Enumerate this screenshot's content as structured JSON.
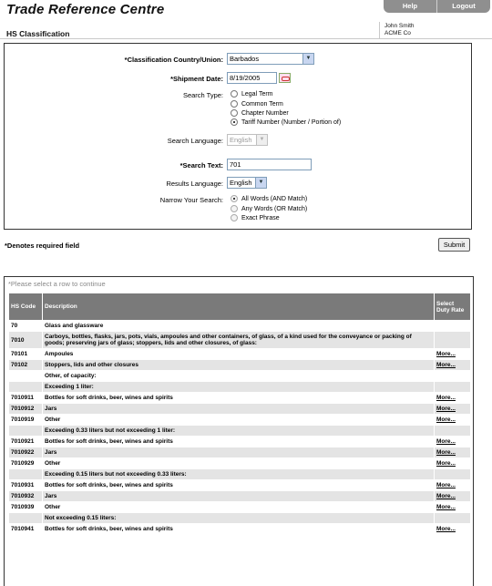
{
  "app_title": "Trade Reference Centre",
  "nav": {
    "help": "Help",
    "logout": "Logout"
  },
  "page_title": "HS Classification",
  "user": {
    "name": "John Smith",
    "company": "ACME Co"
  },
  "form": {
    "country_label": "*Classification Country/Union:",
    "country_value": "Barbados",
    "ship_date_label": "*Shipment Date:",
    "ship_date_value": "8/19/2005",
    "search_type_label": "Search Type:",
    "search_types": [
      {
        "label": "Legal Term",
        "selected": false
      },
      {
        "label": "Common Term",
        "selected": false
      },
      {
        "label": "Chapter Number",
        "selected": false
      },
      {
        "label": "Tariff Number (Number / Portion of)",
        "selected": true
      }
    ],
    "search_lang_label": "Search Language:",
    "search_lang_value": "English",
    "search_text_label": "*Search Text:",
    "search_text_value": "701",
    "results_lang_label": "Results Language:",
    "results_lang_value": "English",
    "narrow_label": "Narrow Your Search:",
    "narrow_options": [
      {
        "label": "All Words (AND Match)",
        "selected": true
      },
      {
        "label": "Any Words (OR Match)",
        "selected": false
      },
      {
        "label": "Exact Phrase",
        "selected": false
      }
    ],
    "required_note": "*Denotes required field",
    "submit_label": "Submit"
  },
  "results": {
    "hint": "*Please select a row to continue",
    "headers": {
      "code": "HS Code",
      "desc": "Description",
      "rate": "Select Duty Rate"
    },
    "rows": [
      {
        "code": "70",
        "desc": "Glass and glassware",
        "more": ""
      },
      {
        "code": "7010",
        "desc": "Carboys, bottles, flasks, jars, pots, vials, ampoules and other containers, of glass, of a kind used for the conveyance or packing of goods; preserving jars of glass; stoppers, lids and other closures, of glass:",
        "more": ""
      },
      {
        "code": "70101",
        "desc": "Ampoules",
        "more": "More..."
      },
      {
        "code": "70102",
        "desc": "Stoppers, lids and other closures",
        "more": "More..."
      },
      {
        "code": "",
        "desc": "Other, of capacity:",
        "more": ""
      },
      {
        "code": "",
        "desc": "Exceeding 1 liter:",
        "more": ""
      },
      {
        "code": "7010911",
        "desc": "Bottles for soft drinks, beer, wines and spirits",
        "more": "More..."
      },
      {
        "code": "7010912",
        "desc": "Jars",
        "more": "More..."
      },
      {
        "code": "7010919",
        "desc": "Other",
        "more": "More..."
      },
      {
        "code": "",
        "desc": "Exceeding 0.33 liters but not exceeding 1 liter:",
        "more": ""
      },
      {
        "code": "7010921",
        "desc": "Bottles for soft drinks, beer, wines and spirits",
        "more": "More..."
      },
      {
        "code": "7010922",
        "desc": "Jars",
        "more": "More..."
      },
      {
        "code": "7010929",
        "desc": "Other",
        "more": "More..."
      },
      {
        "code": "",
        "desc": "Exceeding 0.15 liters but not exceeding 0.33 liters:",
        "more": ""
      },
      {
        "code": "7010931",
        "desc": "Bottles for soft drinks, beer, wines and spirits",
        "more": "More..."
      },
      {
        "code": "7010932",
        "desc": "Jars",
        "more": "More..."
      },
      {
        "code": "7010939",
        "desc": "Other",
        "more": "More..."
      },
      {
        "code": "",
        "desc": "Not exceeding 0.15 liters:",
        "more": ""
      },
      {
        "code": "7010941",
        "desc": "Bottles for soft drinks, beer, wines and spirits",
        "more": "More..."
      }
    ]
  }
}
